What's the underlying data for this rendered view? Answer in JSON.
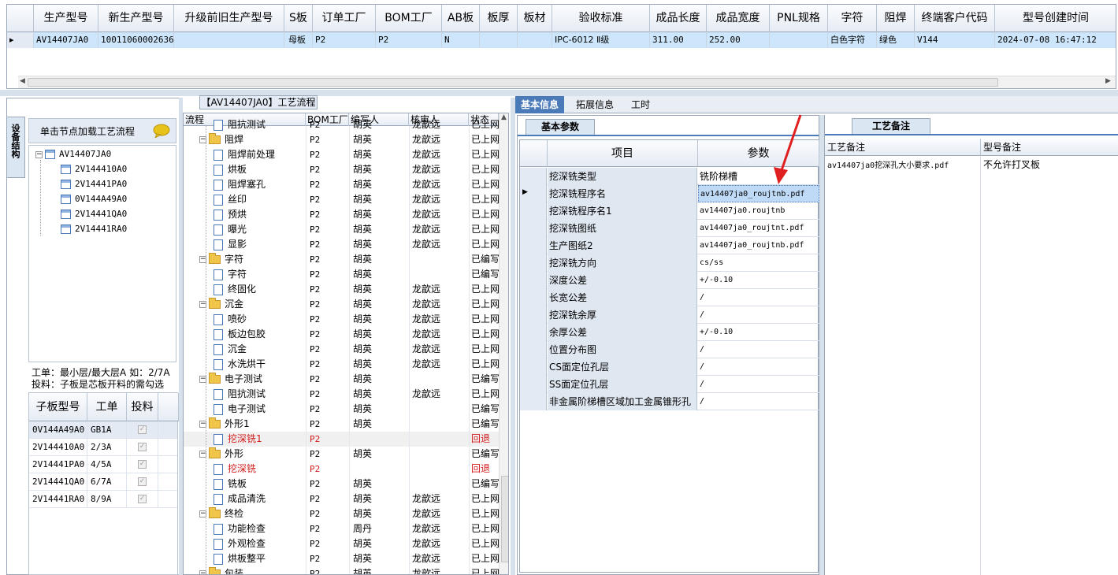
{
  "top_grid": {
    "headers": [
      "生产型号",
      "新生产型号",
      "升级前旧生产型号",
      "S板",
      "订单工厂",
      "BOM工厂",
      "AB板",
      "板厚",
      "板材",
      "验收标准",
      "成品长度",
      "成品宽度",
      "PNL规格",
      "字符",
      "阻焊",
      "终端客户代码",
      "型号创建时间"
    ],
    "row": [
      "AV14407JA0",
      "10011060002636",
      "",
      "母板",
      "P2",
      "P2",
      "N",
      "",
      "",
      "IPC-6012 Ⅱ级",
      "311.00",
      "252.00",
      "",
      "白色字符",
      "绿色",
      "V144",
      "2024-07-08 16:47:12"
    ]
  },
  "left": {
    "vertical_tab": "设备结构",
    "tree_header": "单击节点加载工艺流程",
    "tree_root": "AV14407JA0",
    "tree_children": [
      "2V144410A0",
      "2V14441PA0",
      "0V144A49A0",
      "2V14441QA0",
      "2V14441RA0"
    ],
    "info_line1": "工单：最小层/最大层A 如：2/7A",
    "info_line2": "投料：子板是芯板开料的需勾选",
    "sub_grid_headers": [
      "子板型号",
      "工单",
      "投料"
    ],
    "sub_grid_rows": [
      [
        "0V144A49A0",
        "GB1A"
      ],
      [
        "2V144410A0",
        "2/3A"
      ],
      [
        "2V14441PA0",
        "4/5A"
      ],
      [
        "2V14441QA0",
        "6/7A"
      ],
      [
        "2V14441RA0",
        "8/9A"
      ]
    ]
  },
  "flow": {
    "title": "【AV14407JA0】工艺流程",
    "headers": [
      "流程",
      "BOM工厂",
      "编写人",
      "核审人",
      "状态"
    ],
    "rows": [
      {
        "level": 2,
        "icon": "doc",
        "name": "阻抗测试",
        "bom": "P2",
        "writer": "胡英",
        "reviewer": "龙歆远",
        "status": "已上网"
      },
      {
        "level": 1,
        "icon": "folder",
        "name": "阻焊",
        "bom": "P2",
        "writer": "胡英",
        "reviewer": "龙歆远",
        "status": "已上网"
      },
      {
        "level": 2,
        "icon": "doc",
        "name": "阻焊前处理",
        "bom": "P2",
        "writer": "胡英",
        "reviewer": "龙歆远",
        "status": "已上网"
      },
      {
        "level": 2,
        "icon": "doc",
        "name": "烘板",
        "bom": "P2",
        "writer": "胡英",
        "reviewer": "龙歆远",
        "status": "已上网"
      },
      {
        "level": 2,
        "icon": "doc",
        "name": "阻焊塞孔",
        "bom": "P2",
        "writer": "胡英",
        "reviewer": "龙歆远",
        "status": "已上网"
      },
      {
        "level": 2,
        "icon": "doc",
        "name": "丝印",
        "bom": "P2",
        "writer": "胡英",
        "reviewer": "龙歆远",
        "status": "已上网"
      },
      {
        "level": 2,
        "icon": "doc",
        "name": "预烘",
        "bom": "P2",
        "writer": "胡英",
        "reviewer": "龙歆远",
        "status": "已上网"
      },
      {
        "level": 2,
        "icon": "doc",
        "name": "曝光",
        "bom": "P2",
        "writer": "胡英",
        "reviewer": "龙歆远",
        "status": "已上网"
      },
      {
        "level": 2,
        "icon": "doc",
        "name": "显影",
        "bom": "P2",
        "writer": "胡英",
        "reviewer": "龙歆远",
        "status": "已上网"
      },
      {
        "level": 1,
        "icon": "folder",
        "name": "字符",
        "bom": "P2",
        "writer": "胡英",
        "reviewer": "",
        "status": "已编写"
      },
      {
        "level": 2,
        "icon": "doc",
        "name": "字符",
        "bom": "P2",
        "writer": "胡英",
        "reviewer": "",
        "status": "已编写"
      },
      {
        "level": 2,
        "icon": "doc",
        "name": "终固化",
        "bom": "P2",
        "writer": "胡英",
        "reviewer": "龙歆远",
        "status": "已上网"
      },
      {
        "level": 1,
        "icon": "folder",
        "name": "沉金",
        "bom": "P2",
        "writer": "胡英",
        "reviewer": "龙歆远",
        "status": "已上网"
      },
      {
        "level": 2,
        "icon": "doc",
        "name": "喷砂",
        "bom": "P2",
        "writer": "胡英",
        "reviewer": "龙歆远",
        "status": "已上网"
      },
      {
        "level": 2,
        "icon": "doc",
        "name": "板边包胶",
        "bom": "P2",
        "writer": "胡英",
        "reviewer": "龙歆远",
        "status": "已上网"
      },
      {
        "level": 2,
        "icon": "doc",
        "name": "沉金",
        "bom": "P2",
        "writer": "胡英",
        "reviewer": "龙歆远",
        "status": "已上网"
      },
      {
        "level": 2,
        "icon": "doc",
        "name": "水洗烘干",
        "bom": "P2",
        "writer": "胡英",
        "reviewer": "龙歆远",
        "status": "已上网"
      },
      {
        "level": 1,
        "icon": "folder",
        "name": "电子测试",
        "bom": "P2",
        "writer": "胡英",
        "reviewer": "",
        "status": "已编写"
      },
      {
        "level": 2,
        "icon": "doc",
        "name": "阻抗测试",
        "bom": "P2",
        "writer": "胡英",
        "reviewer": "龙歆远",
        "status": "已上网"
      },
      {
        "level": 2,
        "icon": "doc",
        "name": "电子测试",
        "bom": "P2",
        "writer": "胡英",
        "reviewer": "",
        "status": "已编写"
      },
      {
        "level": 1,
        "icon": "folder",
        "name": "外形1",
        "bom": "P2",
        "writer": "胡英",
        "reviewer": "",
        "status": "已编写"
      },
      {
        "level": 2,
        "icon": "doc",
        "name": "挖深铣1",
        "bom": "P2",
        "writer": "",
        "reviewer": "",
        "status": "回退",
        "red": true,
        "selected": true
      },
      {
        "level": 1,
        "icon": "folder",
        "name": "外形",
        "bom": "P2",
        "writer": "胡英",
        "reviewer": "",
        "status": "已编写"
      },
      {
        "level": 2,
        "icon": "doc",
        "name": "挖深铣",
        "bom": "P2",
        "writer": "",
        "reviewer": "",
        "status": "回退",
        "red": true
      },
      {
        "level": 2,
        "icon": "doc",
        "name": "铣板",
        "bom": "P2",
        "writer": "胡英",
        "reviewer": "",
        "status": "已编写"
      },
      {
        "level": 2,
        "icon": "doc",
        "name": "成品清洗",
        "bom": "P2",
        "writer": "胡英",
        "reviewer": "龙歆远",
        "status": "已上网"
      },
      {
        "level": 1,
        "icon": "folder",
        "name": "终检",
        "bom": "P2",
        "writer": "胡英",
        "reviewer": "龙歆远",
        "status": "已上网"
      },
      {
        "level": 2,
        "icon": "doc",
        "name": "功能检查",
        "bom": "P2",
        "writer": "周丹",
        "reviewer": "龙歆远",
        "status": "已上网"
      },
      {
        "level": 2,
        "icon": "doc",
        "name": "外观检查",
        "bom": "P2",
        "writer": "胡英",
        "reviewer": "龙歆远",
        "status": "已上网"
      },
      {
        "level": 2,
        "icon": "doc",
        "name": "烘板整平",
        "bom": "P2",
        "writer": "胡英",
        "reviewer": "龙歆远",
        "status": "已上网"
      },
      {
        "level": 1,
        "icon": "folder",
        "name": "包装",
        "bom": "P2",
        "writer": "胡英",
        "reviewer": "龙歆远",
        "status": "已上网"
      }
    ]
  },
  "tabs": [
    "基本信息",
    "拓展信息",
    "工时"
  ],
  "params": {
    "tab": "基本参数",
    "col_item": "项目",
    "col_value": "参数",
    "rows": [
      {
        "k": "挖深铣类型",
        "v": "铣阶梯槽",
        "cn": true
      },
      {
        "k": "挖深铣程序名",
        "v": "av14407ja0_roujtnb.pdf",
        "selected": true
      },
      {
        "k": "挖深铣程序名1",
        "v": "av14407ja0.roujtnb"
      },
      {
        "k": "挖深铣图纸",
        "v": "av14407ja0_roujtnt.pdf"
      },
      {
        "k": "生产图纸2",
        "v": "av14407ja0_roujtnb.pdf"
      },
      {
        "k": "挖深铣方向",
        "v": "cs/ss"
      },
      {
        "k": "深度公差",
        "v": "+/-0.10"
      },
      {
        "k": "长宽公差",
        "v": "/"
      },
      {
        "k": "挖深铣余厚",
        "v": "/"
      },
      {
        "k": "余厚公差",
        "v": "+/-0.10"
      },
      {
        "k": "位置分布图",
        "v": "/"
      },
      {
        "k": "CS面定位孔层",
        "v": "/"
      },
      {
        "k": "SS面定位孔层",
        "v": "/"
      },
      {
        "k": "非金属阶梯槽区域加工金属锥形孔",
        "v": "/"
      }
    ]
  },
  "notes": {
    "tab": "工艺备注",
    "col1": "工艺备注",
    "col2": "型号备注",
    "val1": "av14407ja0挖深孔大小要求.pdf",
    "val2": "不允许打叉板"
  },
  "colors": {
    "accent": "#4a7ab8",
    "selected_row": "#cde6fb",
    "red": "#d21a1a",
    "arrow": "#e02020"
  }
}
